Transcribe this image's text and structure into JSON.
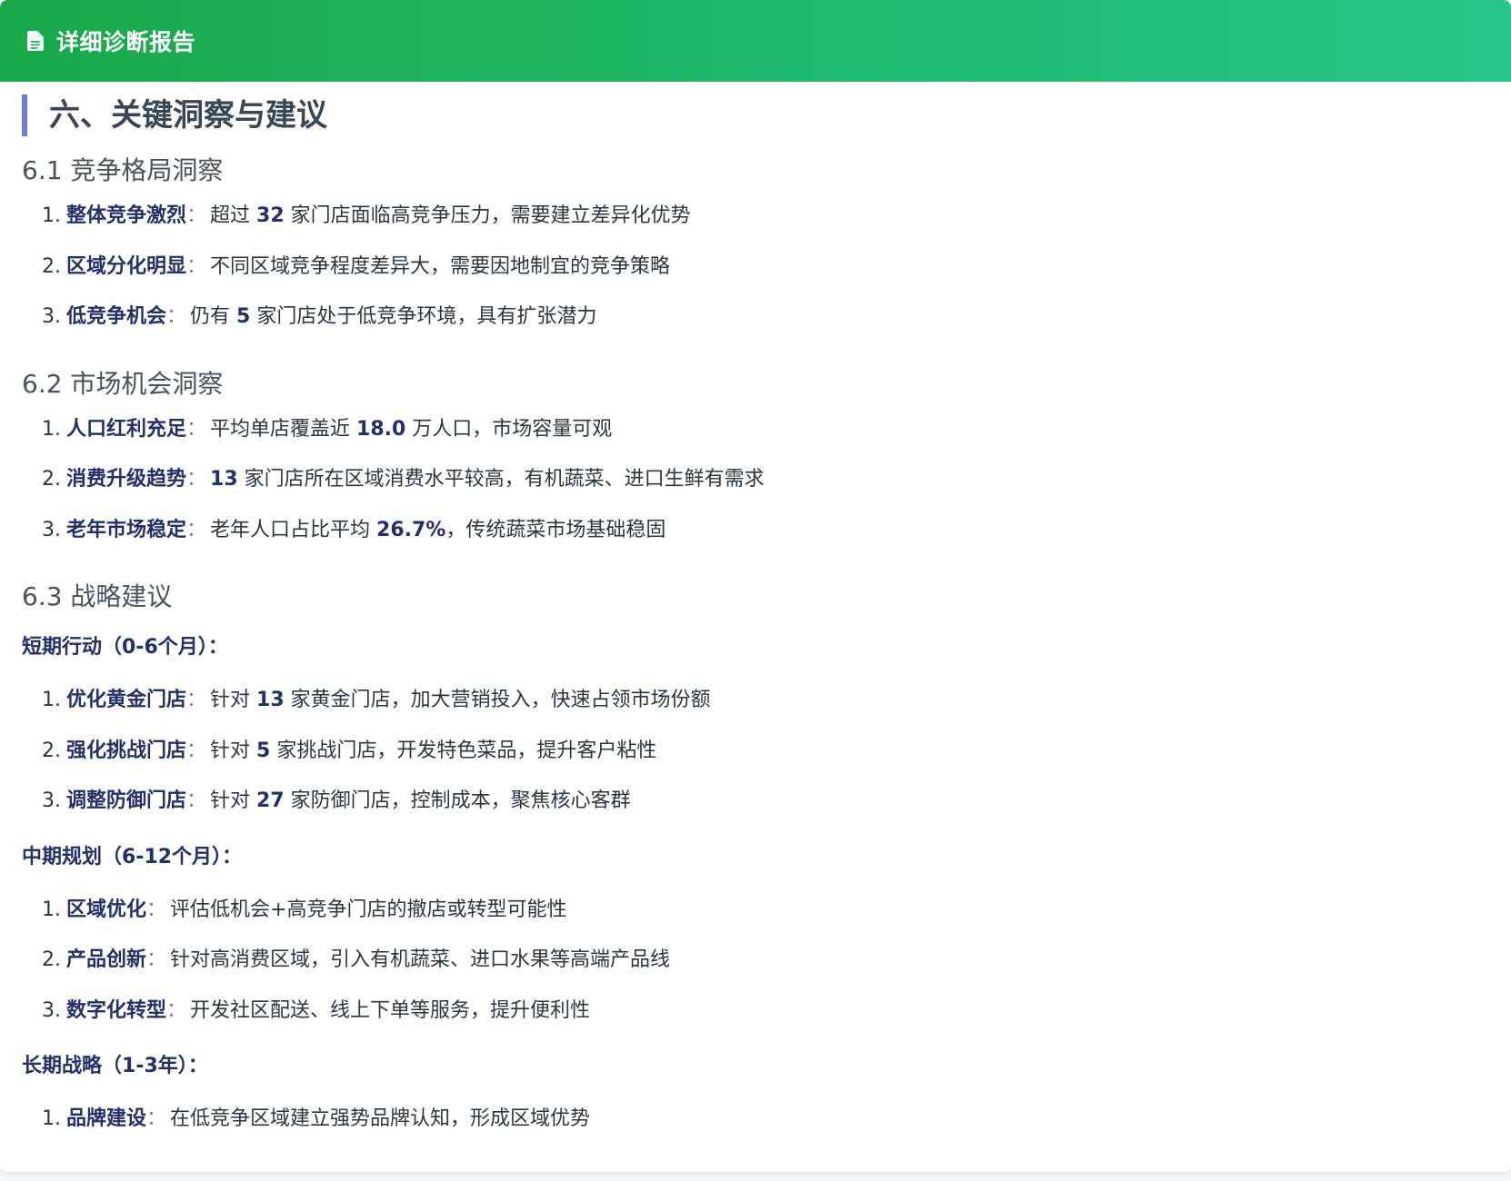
{
  "header": {
    "icon": "document-icon",
    "title": "详细诊断报告",
    "colors": {
      "gradient_start": "#1aa94a",
      "gradient_end": "#25c48a"
    }
  },
  "section": {
    "title": "六、关键洞察与建议",
    "accent_color": "#6b7fd6"
  },
  "competition": {
    "title": "6.1 竞争格局洞察",
    "items": [
      {
        "num": "1.",
        "keyword": "整体竞争激烈",
        "colon": "：",
        "pre": "超过 ",
        "value": "32",
        "post": " 家门店面临高竞争压力，需要建立差异化优势"
      },
      {
        "num": "2.",
        "keyword": "区域分化明显",
        "colon": "：",
        "text": "不同区域竞争程度差异大，需要因地制宜的竞争策略"
      },
      {
        "num": "3.",
        "keyword": "低竞争机会",
        "colon": "：",
        "pre": "仍有 ",
        "value": "5",
        "post": " 家门店处于低竞争环境，具有扩张潜力"
      }
    ]
  },
  "market": {
    "title": "6.2 市场机会洞察",
    "items": [
      {
        "num": "1.",
        "keyword": "人口红利充足",
        "colon": "：",
        "pre": "平均单店覆盖近 ",
        "value": "18.0",
        "post": " 万人口，市场容量可观"
      },
      {
        "num": "2.",
        "keyword": "消费升级趋势",
        "colon": "：",
        "pre": "",
        "value": "13",
        "post": " 家门店所在区域消费水平较高，有机蔬菜、进口生鲜有需求"
      },
      {
        "num": "3.",
        "keyword": "老年市场稳定",
        "colon": "：",
        "pre": "老年人口占比平均 ",
        "value": "26.7%",
        "post": "，传统蔬菜市场基础稳固"
      }
    ]
  },
  "strategy": {
    "title": "6.3 战略建议",
    "short_term": {
      "label": "短期行动（0-6个月）：",
      "items": [
        {
          "num": "1.",
          "keyword": "优化黄金门店",
          "colon": "：",
          "pre": "针对 ",
          "value": "13",
          "post": " 家黄金门店，加大营销投入，快速占领市场份额"
        },
        {
          "num": "2.",
          "keyword": "强化挑战门店",
          "colon": "：",
          "pre": "针对 ",
          "value": "5",
          "post": " 家挑战门店，开发特色菜品，提升客户粘性"
        },
        {
          "num": "3.",
          "keyword": "调整防御门店",
          "colon": "：",
          "pre": "针对 ",
          "value": "27",
          "post": " 家防御门店，控制成本，聚焦核心客群"
        }
      ]
    },
    "mid_term": {
      "label": "中期规划（6-12个月）：",
      "items": [
        {
          "num": "1.",
          "keyword": "区域优化",
          "colon": "：",
          "text": "评估低机会+高竞争门店的撤店或转型可能性"
        },
        {
          "num": "2.",
          "keyword": "产品创新",
          "colon": "：",
          "text": "针对高消费区域，引入有机蔬菜、进口水果等高端产品线"
        },
        {
          "num": "3.",
          "keyword": "数字化转型",
          "colon": "：",
          "text": "开发社区配送、线上下单等服务，提升便利性"
        }
      ]
    },
    "long_term": {
      "label": "长期战略（1-3年）：",
      "items": [
        {
          "num": "1.",
          "keyword": "品牌建设",
          "colon": "：",
          "text": "在低竞争区域建立强势品牌认知，形成区域优势"
        }
      ]
    }
  }
}
